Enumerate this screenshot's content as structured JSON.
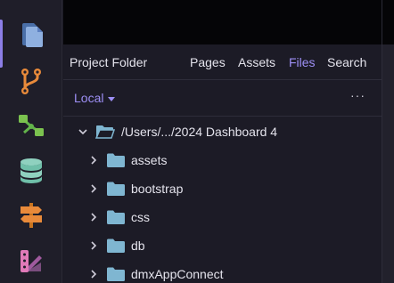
{
  "activity_bar": {
    "items": [
      {
        "name": "pages-icon"
      },
      {
        "name": "git-branch-icon"
      },
      {
        "name": "flow-tree-icon"
      },
      {
        "name": "database-icon"
      },
      {
        "name": "signpost-icon"
      },
      {
        "name": "design-palette-icon"
      }
    ],
    "accent": "#8c7ee6"
  },
  "panel": {
    "title": "Project Folder",
    "tabs": [
      {
        "label": "Pages",
        "active": false
      },
      {
        "label": "Assets",
        "active": false
      },
      {
        "label": "Files",
        "active": true
      },
      {
        "label": "Search",
        "active": false
      }
    ],
    "location_select": "Local",
    "more_label": "···"
  },
  "tree": {
    "root": {
      "label": "/Users/.../2024 Dashboard 4",
      "expanded": true
    },
    "children": [
      {
        "label": "assets"
      },
      {
        "label": "bootstrap"
      },
      {
        "label": "css"
      },
      {
        "label": "db"
      },
      {
        "label": "dmxAppConnect"
      }
    ],
    "folder_color": "#7fb6d1"
  }
}
